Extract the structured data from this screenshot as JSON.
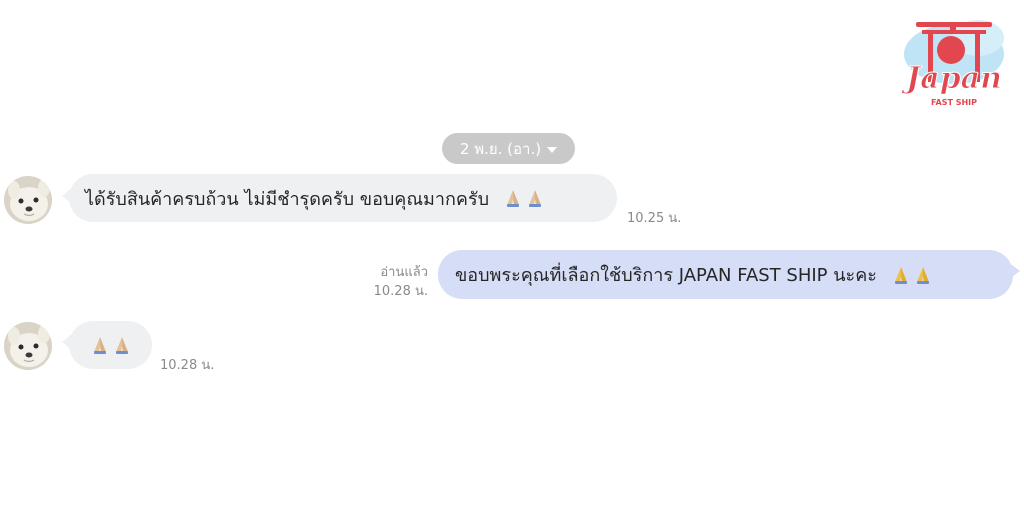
{
  "logo": {
    "brand": "Japan",
    "tagline": "FAST SHIP"
  },
  "date_separator": {
    "label": "2 พ.ย. (อา.)",
    "icon": "chevron-down-icon"
  },
  "messages": [
    {
      "direction": "incoming",
      "text": "ได้รับสินค้าครบถ้วน ไม่มีชำรุดครับ ขอบคุณมากครับ",
      "emoji": "folded-hands-icon x2",
      "time": "10.25 น."
    },
    {
      "direction": "outgoing",
      "text": "ขอบพระคุณที่เลือกใช้บริการ JAPAN FAST SHIP นะคะ",
      "emoji": "folded-hands-icon x2",
      "read_status": "อ่านแล้ว",
      "time": "10.28 น."
    },
    {
      "direction": "incoming",
      "text": "",
      "emoji": "folded-hands-icon x2",
      "time": "10.28 น."
    }
  ],
  "colors": {
    "incoming_bubble": "#eef0f2",
    "outgoing_bubble": "#d6ddf6",
    "date_pill": "#c9c9c9",
    "logo_red": "#e2474f",
    "logo_sky": "#bfe4f5"
  }
}
